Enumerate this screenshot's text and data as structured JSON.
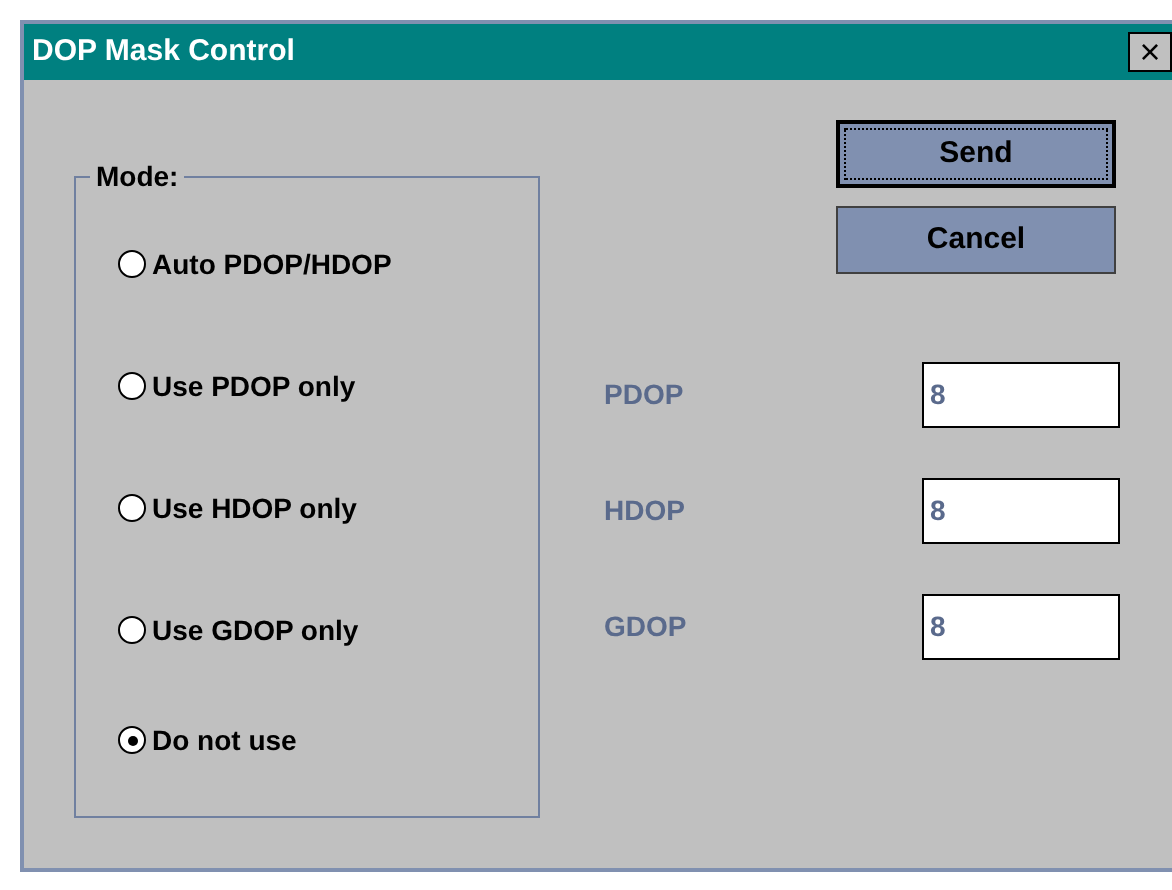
{
  "window": {
    "title": "DOP Mask Control",
    "close": "×"
  },
  "mode": {
    "title": "Mode:",
    "options": [
      {
        "label": "Auto PDOP/HDOP",
        "selected": false
      },
      {
        "label": "Use PDOP only",
        "selected": false
      },
      {
        "label": "Use HDOP only",
        "selected": false
      },
      {
        "label": "Use GDOP only",
        "selected": false
      },
      {
        "label": "Do not use",
        "selected": true
      }
    ]
  },
  "fields": [
    {
      "label": "PDOP",
      "value": "8"
    },
    {
      "label": "HDOP",
      "value": "8"
    },
    {
      "label": "GDOP",
      "value": "8"
    }
  ],
  "buttons": [
    {
      "label": "Send",
      "default": true
    },
    {
      "label": "Cancel",
      "default": false
    }
  ]
}
